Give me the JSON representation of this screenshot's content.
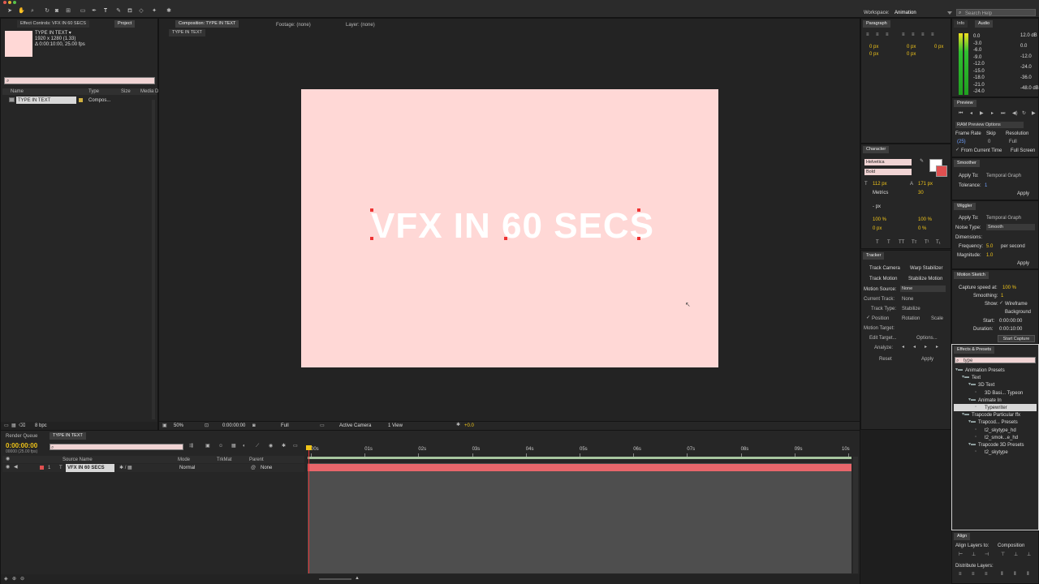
{
  "app": {
    "workspace_label": "Workspace:",
    "workspace_value": "Animation",
    "search_help": "Search Help"
  },
  "effect_controls": {
    "tab": "Effect Controls: VFX IN 60 SECS"
  },
  "project": {
    "tab": "Project",
    "comp_name": "TYPE IN TEXT ▾",
    "comp_info_1": "1920 x 1280 (1.33)",
    "comp_info_2": "Δ 0:00:10:00, 25.00 fps",
    "col_name": "Name",
    "col_type": "Type",
    "col_size": "Size",
    "col_media": "Media D",
    "item_name": "TYPE IN TEXT",
    "item_type": "Compos...",
    "bpc": "8 bpc"
  },
  "viewer": {
    "comp_tab": "Composition: TYPE IN TEXT",
    "footage_tab": "Footage: (none)",
    "layer_tab": "Layer: (none)",
    "breadcrumb": "TYPE IN TEXT",
    "text": "VFX IN 60 SECS",
    "bg_color": "#ffd8d6",
    "zoom": "50%",
    "timecode": "0:00:00:00",
    "resolution": "Full",
    "camera": "Active Camera",
    "views": "1 View",
    "exposure": "+0.0"
  },
  "paragraph": {
    "tab": "Paragraph",
    "indent_left": "0 px",
    "indent_right": "0 px",
    "indent_first": "0 px",
    "space_before": "0 px",
    "space_after": "0 px"
  },
  "character": {
    "tab": "Character",
    "font": "Helvetica",
    "style": "Bold",
    "size": "112 px",
    "leading": "171 px",
    "kerning": "Metrics",
    "tracking": "30",
    "stroke": "- px",
    "vscale": "100 %",
    "hscale": "100 %",
    "baseline": "0 px",
    "tsume": "0 %"
  },
  "tracker": {
    "tab": "Tracker",
    "track_camera": "Track Camera",
    "warp_stabilizer": "Warp Stabilizer",
    "track_motion": "Track Motion",
    "stabilize_motion": "Stabilize Motion",
    "motion_source_label": "Motion Source:",
    "motion_source": "None",
    "current_track_label": "Current Track:",
    "current_track": "None",
    "track_type_label": "Track Type:",
    "track_type": "Stabilize",
    "position": "Position",
    "rotation": "Rotation",
    "scale": "Scale",
    "motion_target": "Motion Target:",
    "edit_target": "Edit Target...",
    "options": "Options...",
    "analyze": "Analyze:",
    "reset": "Reset",
    "apply": "Apply"
  },
  "info": {
    "tab_info": "Info",
    "tab_audio": "Audio",
    "db_left": [
      "0.0",
      "-3.0",
      "-6.0",
      "-9.0",
      "-12.0",
      "-15.0",
      "-18.0",
      "-21.0",
      "-24.0"
    ],
    "db_right": [
      "12.0 dB",
      "0.0",
      "-12.0",
      "-24.0",
      "-36.0",
      "-48.0 dB"
    ]
  },
  "preview": {
    "tab": "Preview",
    "ram_options": "RAM Preview Options",
    "frame_rate_label": "Frame Rate",
    "skip_label": "Skip",
    "resolution_label": "Resolution",
    "frame_rate": "(25)",
    "skip": "0",
    "resolution": "Full",
    "from_current": "From Current Time",
    "full_screen": "Full Screen"
  },
  "smoother": {
    "tab": "Smoother",
    "apply_to_label": "Apply To:",
    "apply_to": "Temporal Graph",
    "tolerance_label": "Tolerance:",
    "tolerance": "1",
    "apply": "Apply"
  },
  "wiggler": {
    "tab": "Wiggler",
    "apply_to_label": "Apply To:",
    "apply_to": "Temporal Graph",
    "noise_label": "Noise Type:",
    "noise": "Smooth",
    "dimensions_label": "Dimensions:",
    "frequency_label": "Frequency:",
    "frequency": "5.0",
    "frequency_unit": "per second",
    "magnitude_label": "Magnitude:",
    "magnitude": "1.0",
    "apply": "Apply"
  },
  "motion_sketch": {
    "tab": "Motion Sketch",
    "capture_speed_label": "Capture speed at:",
    "capture_speed": "100 %",
    "smoothing_label": "Smoothing:",
    "smoothing": "1",
    "show_label": "Show:",
    "wireframe": "Wireframe",
    "background": "Background",
    "start_label": "Start:",
    "start": "0:00:00:00",
    "duration_label": "Duration:",
    "duration": "0:00:10:00",
    "start_capture": "Start Capture"
  },
  "effects": {
    "tab": "Effects & Presets",
    "search": "type",
    "tree": [
      {
        "label": "Animation Presets",
        "depth": 0,
        "kind": "folder"
      },
      {
        "label": "Text",
        "depth": 1,
        "kind": "folder"
      },
      {
        "label": "3D Text",
        "depth": 2,
        "kind": "folder"
      },
      {
        "label": "3D Basi... Typeon",
        "depth": 3,
        "kind": "item"
      },
      {
        "label": "Animate In",
        "depth": 2,
        "kind": "folder"
      },
      {
        "label": "Typewriter",
        "depth": 3,
        "kind": "item",
        "selected": true
      },
      {
        "label": "Trapcode Particular ffx",
        "depth": 1,
        "kind": "folder"
      },
      {
        "label": "Trapcod... Presets",
        "depth": 2,
        "kind": "folder"
      },
      {
        "label": "t2_skytype_hd",
        "depth": 3,
        "kind": "item"
      },
      {
        "label": "t2_smok...e_hd",
        "depth": 3,
        "kind": "item"
      },
      {
        "label": "Trapcode 3D Presets",
        "depth": 2,
        "kind": "folder"
      },
      {
        "label": "t2_skytype",
        "depth": 3,
        "kind": "item"
      }
    ]
  },
  "align": {
    "tab": "Align",
    "align_to_label": "Align Layers to:",
    "align_to": "Composition",
    "distribute": "Distribute Layers:"
  },
  "timeline": {
    "render_queue_tab": "Render Queue",
    "comp_tab": "TYPE IN TEXT",
    "timecode": "0:00:00:00",
    "fps": "00000 (25.00 fps)",
    "col_source": "Source Name",
    "col_mode": "Mode",
    "col_trkmat": "TrkMat",
    "col_parent": "Parent",
    "layer_num": "1",
    "layer_name": "VFX IN 60 SECS",
    "layer_mode": "Normal",
    "layer_parent": "None",
    "ticks": [
      "00s",
      "01s",
      "02s",
      "03s",
      "04s",
      "05s",
      "06s",
      "07s",
      "08s",
      "09s",
      "10s"
    ]
  },
  "colors": {
    "accent": "#f0c419",
    "layer_bar": "#e8666b",
    "work_area": "#a8c6a0",
    "playhead": "#e23333"
  }
}
